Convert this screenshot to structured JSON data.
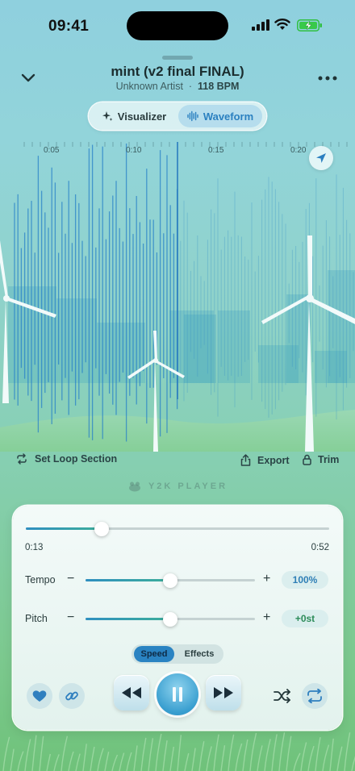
{
  "status": {
    "time": "09:41"
  },
  "track": {
    "title": "mint (v2 final FINAL)",
    "artist": "Unknown Artist",
    "separator": "·",
    "bpm": "118 BPM"
  },
  "view_toggle": {
    "visualizer": "Visualizer",
    "waveform": "Waveform",
    "selected": "Waveform"
  },
  "timeline": {
    "ticks": [
      "0:05",
      "0:10",
      "0:15",
      "0:20"
    ]
  },
  "actions": {
    "loop": "Set Loop Section",
    "export": "Export",
    "trim": "Trim"
  },
  "brand": "Y2K PLAYER",
  "playback": {
    "elapsed": "0:13",
    "total": "0:52",
    "progress": 0.25,
    "tempo": {
      "label": "Tempo",
      "value": "100%",
      "level": 0.5
    },
    "pitch": {
      "label": "Pitch",
      "value": "+0st",
      "level": 0.5
    },
    "minus": "−",
    "plus": "+",
    "modes": [
      "Speed",
      "Effects"
    ],
    "active_mode": "Speed"
  },
  "icons": [
    "chevron-down-icon",
    "more-icon",
    "sparkle-icon",
    "waveform-icon",
    "location-arrow-icon",
    "loop-icon",
    "share-icon",
    "lock-icon",
    "heart-icon",
    "link-icon",
    "rewind-icon",
    "pause-icon",
    "fast-forward-icon",
    "shuffle-icon",
    "repeat-icon"
  ],
  "colors": {
    "accent": "#2a83c2",
    "pitch_value": "#2d8c5a",
    "waveform": "#2f8fc0"
  }
}
